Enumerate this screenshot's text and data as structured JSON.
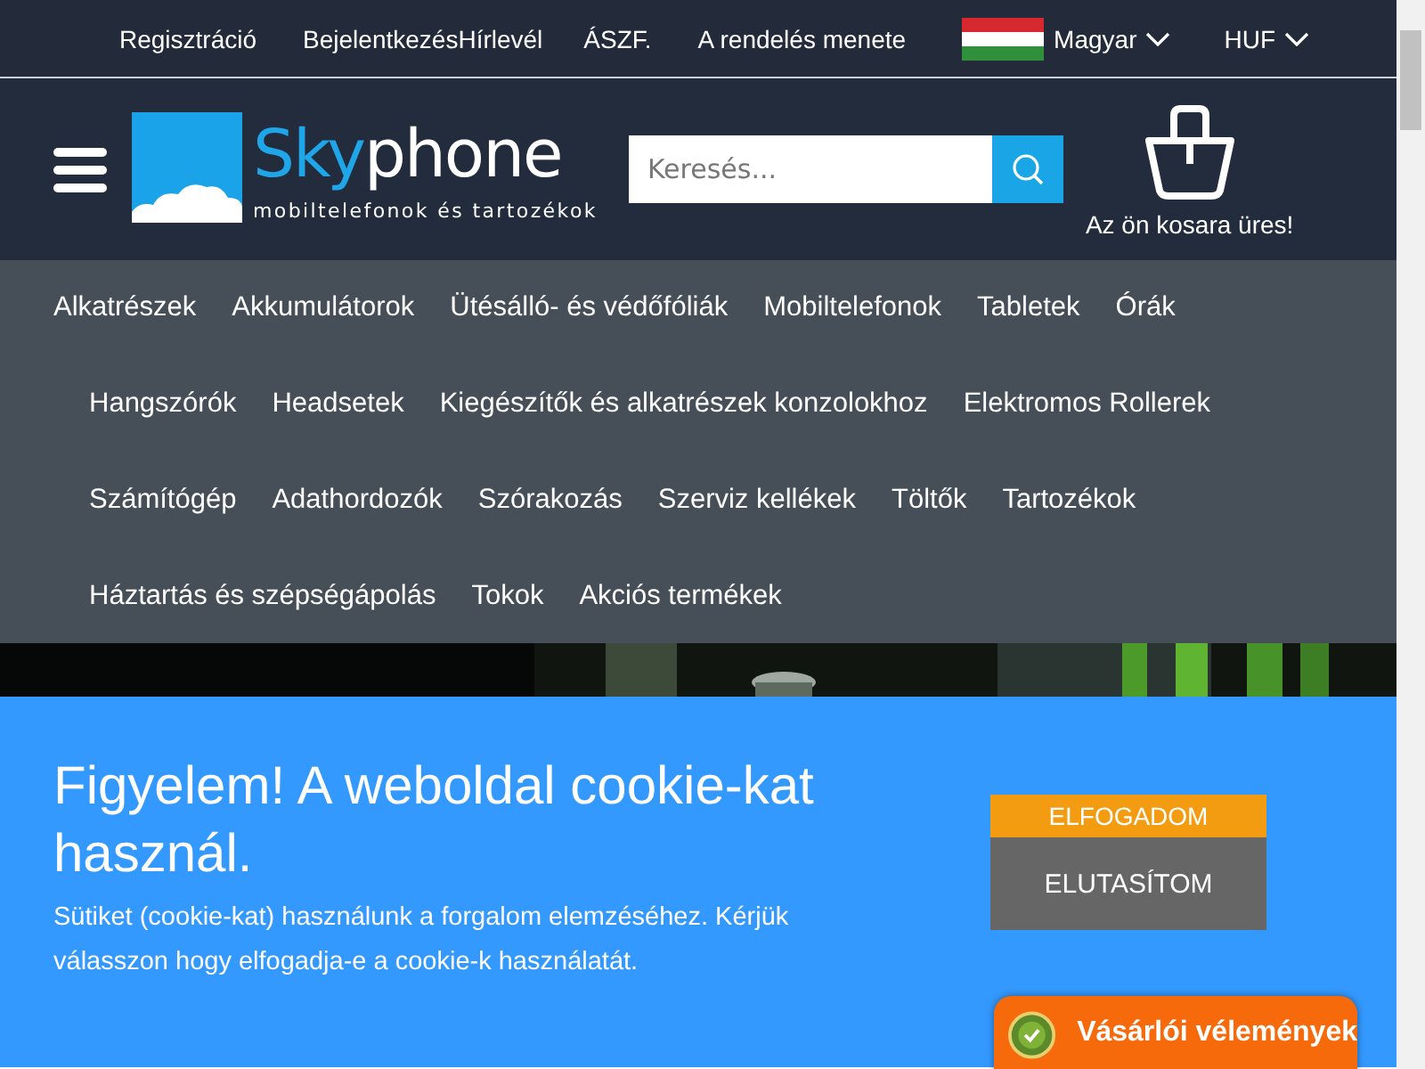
{
  "top_links": [
    "Regisztráció",
    "Bejelentkezés",
    "Hírlevél",
    "ÁSZF.",
    "A rendelés menete"
  ],
  "language": {
    "label": "Magyar"
  },
  "currency": {
    "label": "HUF"
  },
  "logo": {
    "brand_first": "Sky",
    "brand_second": "phone",
    "tagline": "mobiltelefonok és tartozékok"
  },
  "search": {
    "placeholder": "Keresés..."
  },
  "cart": {
    "label": "Az ön kosara üres!"
  },
  "categories": [
    [
      "Alkatrészek",
      "Akkumulátorok",
      "Ütésálló- és védőfóliák",
      "Mobiltelefonok",
      "Tabletek",
      "Órák"
    ],
    [
      "Hangszórók",
      "Headsetek",
      "Kiegészítők és alkatrészek konzolokhoz",
      "Elektromos Rollerek"
    ],
    [
      "Számítógép",
      "Adathordozók",
      "Szórakozás",
      "Szerviz kellékek",
      "Töltők",
      "Tartozékok"
    ],
    [
      "Háztartás és szépségápolás",
      "Tokok",
      "Akciós termékek"
    ]
  ],
  "hero": {
    "kind": "picture"
  },
  "cookie_banner": {
    "title": "Figyelem! A weboldal cookie-kat használ.",
    "text": "Sütiket (cookie-kat) használunk a forgalom elemzéséhez. Kérjük válasszon hogy elfogadja-e a cookie-k használatát.",
    "accept": "ELFOGADOM",
    "reject": "ELUTASÍTOM"
  },
  "reviews_badge": {
    "label": "Vásárlói vélemények"
  }
}
